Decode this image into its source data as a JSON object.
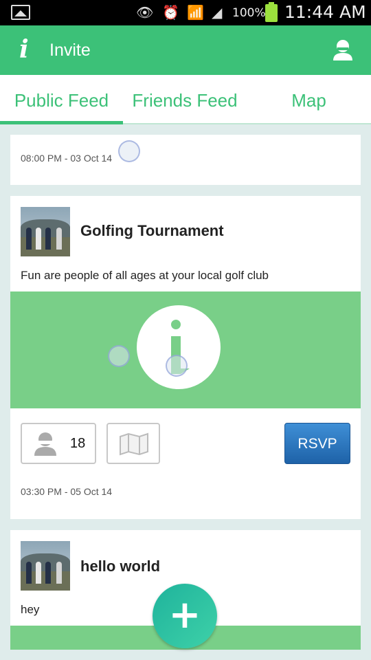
{
  "status_bar": {
    "battery": "100%",
    "time": "11:44 AM"
  },
  "app_bar": {
    "logo": "i",
    "title": "Invite"
  },
  "tabs": [
    {
      "label": "Public Feed",
      "active": true
    },
    {
      "label": "Friends Feed",
      "active": false
    },
    {
      "label": "Map",
      "active": false
    }
  ],
  "feed": [
    {
      "date": "08:00 PM - 03 Oct 14"
    },
    {
      "title": "Golfing Tournament",
      "description": "Fun are people of all ages at your local golf club",
      "attendees": "18",
      "rsvp_label": "RSVP",
      "date": "03:30 PM - 05 Oct 14"
    },
    {
      "title": "hello world",
      "description": "hey"
    }
  ],
  "fab": {
    "label": "+"
  },
  "colors": {
    "brand_green": "#3cc178",
    "banner_green": "#79cf88",
    "rsvp_blue": "#2a74c0",
    "background": "#dfeceb"
  }
}
